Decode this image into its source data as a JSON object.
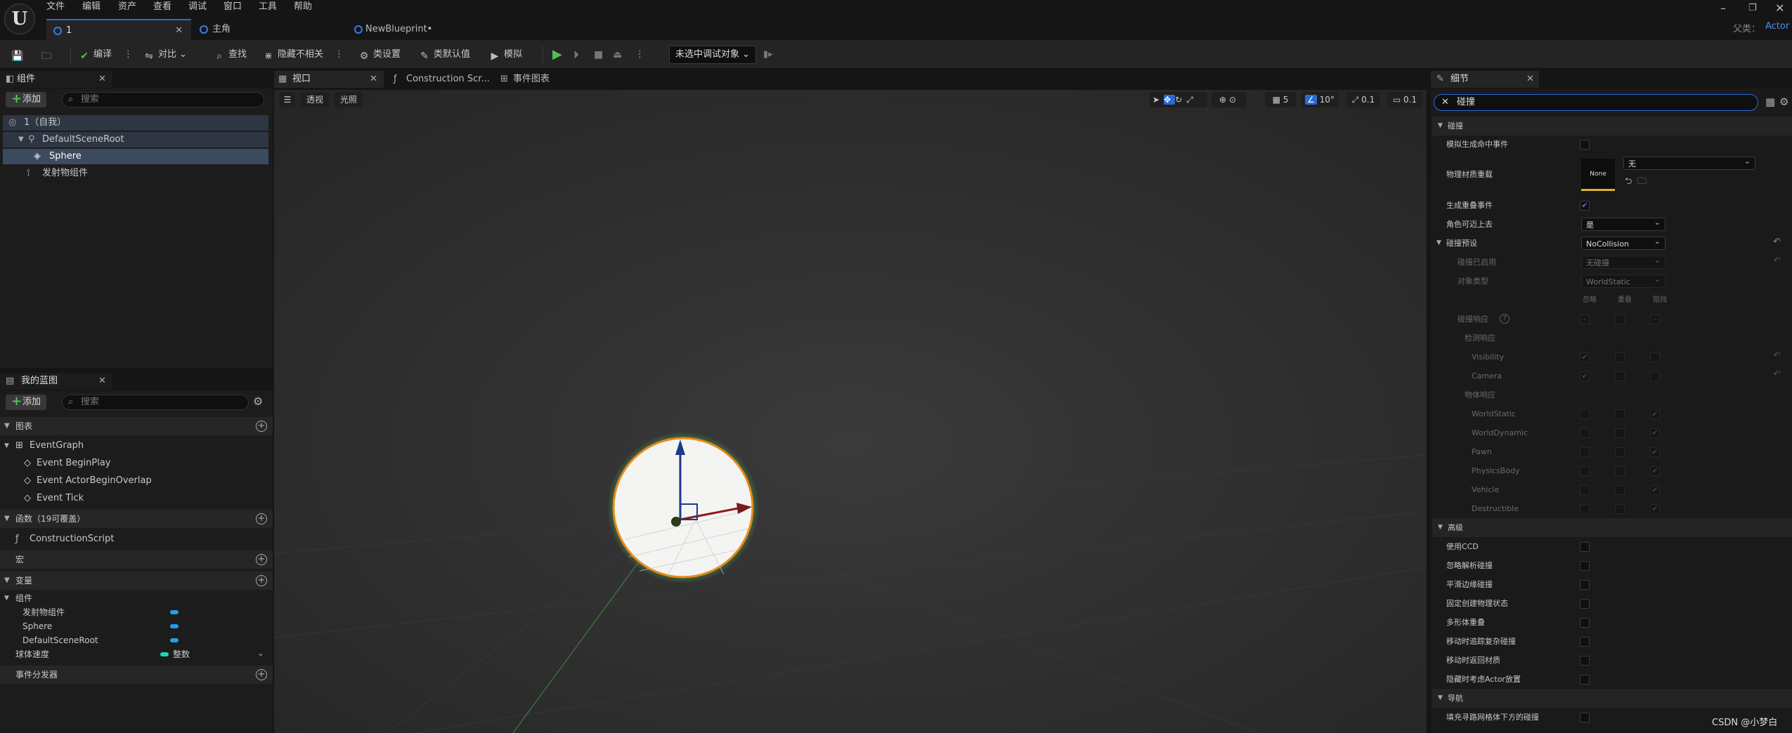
{
  "menu": [
    "文件",
    "编辑",
    "资产",
    "查看",
    "调试",
    "窗口",
    "工具",
    "帮助"
  ],
  "doc_tabs": [
    {
      "label": "1",
      "active": true
    },
    {
      "label": "主角",
      "active": false
    },
    {
      "label": "NewBlueprint•",
      "active": false
    }
  ],
  "parent_label": "父类：",
  "parent_value": "Actor",
  "toolbar": {
    "compile": "编译",
    "diff": "对比",
    "find": "查找",
    "hide_unrelated": "隐藏不相关",
    "class_settings": "类设置",
    "class_defaults": "类默认值",
    "simulate": "模拟",
    "debug_target": "未选中调试对象"
  },
  "components": {
    "title": "组件",
    "add": "添加",
    "search_placeholder": "搜索",
    "items": [
      "1（自我）",
      "DefaultSceneRoot",
      "Sphere",
      "发射物组件"
    ]
  },
  "my_blueprint": {
    "title": "我的蓝图",
    "add": "添加",
    "search_placeholder": "搜索",
    "graphs_header": "图表",
    "event_graph": "EventGraph",
    "events": [
      "Event BeginPlay",
      "Event ActorBeginOverlap",
      "Event Tick"
    ],
    "functions_header": "函数（19可覆盖）",
    "construction": "ConstructionScript",
    "macros_header": "宏",
    "variables_header": "变量",
    "components_group": "组件",
    "component_vars": [
      "发射物组件",
      "Sphere",
      "DefaultSceneRoot"
    ],
    "var_ball_speed": "球体速度",
    "var_ball_speed_type": "整数",
    "dispatchers_header": "事件分发器"
  },
  "editor_tabs": [
    "视口",
    "Construction Scr...",
    "事件图表"
  ],
  "viewport": {
    "perspective": "透视",
    "lit": "光照",
    "grid": "5",
    "angle": "10°",
    "scale": "0.1",
    "cam": "0.1"
  },
  "details": {
    "title": "细节",
    "search": "碰撞",
    "section_collision": "碰撞",
    "sim_hit": "模拟生成命中事件",
    "phys_override": "物理材质重载",
    "none_thumb": "None",
    "phys_value": "无",
    "gen_overlap": "生成重叠事件",
    "can_step": "角色可迈上去",
    "can_step_value": "是",
    "presets": "碰撞预设",
    "presets_value": "NoCollision",
    "enabled": "碰撞已启用",
    "enabled_value": "无碰撞",
    "object_type": "对象类型",
    "object_type_value": "WorldStatic",
    "col_ignore": "忽略",
    "col_overlap": "重叠",
    "col_block": "阻挡",
    "responses": "碰撞响应",
    "trace": "检测响应",
    "trace_items": [
      "Visibility",
      "Camera"
    ],
    "object_responses": "物体响应",
    "object_items": [
      "WorldStatic",
      "WorldDynamic",
      "Pawn",
      "PhysicsBody",
      "Vehicle",
      "Destructible"
    ],
    "section_advanced": "高级",
    "advanced_items": [
      "使用CCD",
      "忽略解析碰撞",
      "平滑边缘碰撞",
      "固定创建物理状态",
      "多形体重叠",
      "移动时追踪复杂碰撞",
      "移动时返回材质",
      "隐藏时考虑Actor放置"
    ],
    "section_nav": "导航",
    "nav_item": "填充寻路网格体下方的碰撞"
  },
  "watermark": "CSDN @小梦白"
}
